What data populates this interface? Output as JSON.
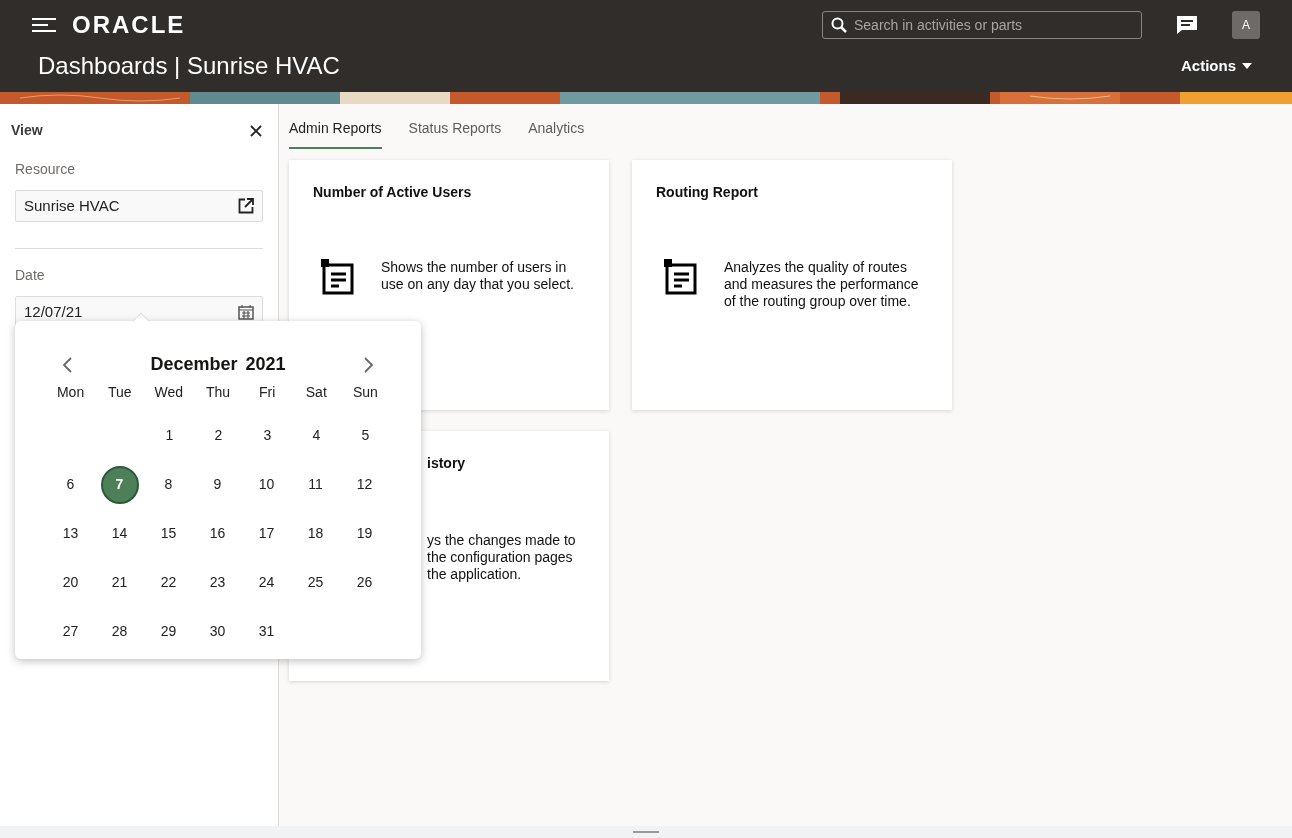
{
  "header": {
    "logo": "ORACLE",
    "search": {
      "placeholder": "Search in activities or parts"
    },
    "avatar": "A",
    "title": "Dashboards | Sunrise HVAC",
    "actions": "Actions"
  },
  "sidebar": {
    "title": "View",
    "fields": [
      {
        "label": "Resource",
        "value": "Sunrise HVAC",
        "kind": "link"
      },
      {
        "label": "Date",
        "value": "12/07/21",
        "kind": "date"
      }
    ]
  },
  "tabs": [
    {
      "label": "Admin Reports",
      "selected": true
    },
    {
      "label": "Status Reports",
      "selected": false
    },
    {
      "label": "Analytics",
      "selected": false
    }
  ],
  "cards": [
    {
      "title": "Number of Active Users",
      "description": [
        "Shows the number of users in",
        "use on any day that you select."
      ],
      "covered": false
    },
    {
      "title": "Routing Report",
      "description": [
        "Analyzes the quality of routes",
        "and measures the performance",
        "of the routing group over time."
      ],
      "covered": false
    },
    {
      "title": "istory",
      "description": [
        "ys the changes made to",
        "the configuration pages",
        "the application."
      ],
      "covered": true
    }
  ],
  "calendar": {
    "month": "December",
    "year": "2021",
    "weekdays": [
      "Mon",
      "Tue",
      "Wed",
      "Thu",
      "Fri",
      "Sat",
      "Sun"
    ],
    "weeks": [
      [
        {
          "label": "1",
          "selected": false
        },
        {
          "label": "2",
          "selected": false
        },
        {
          "label": "3",
          "selected": false
        },
        {
          "label": "4",
          "selected": false
        },
        {
          "label": "5",
          "selected": false
        }
      ],
      [
        {
          "label": "6",
          "selected": false
        },
        {
          "label": "7",
          "selected": true
        },
        {
          "label": "8",
          "selected": false
        },
        {
          "label": "9",
          "selected": false
        },
        {
          "label": "10",
          "selected": false
        },
        {
          "label": "11",
          "selected": false
        },
        {
          "label": "12",
          "selected": false
        }
      ],
      [
        {
          "label": "13",
          "selected": false
        },
        {
          "label": "14",
          "selected": false
        },
        {
          "label": "15",
          "selected": false
        },
        {
          "label": "16",
          "selected": false
        },
        {
          "label": "17",
          "selected": false
        },
        {
          "label": "18",
          "selected": false
        },
        {
          "label": "19",
          "selected": false
        }
      ],
      [
        {
          "label": "20",
          "selected": false
        },
        {
          "label": "21",
          "selected": false
        },
        {
          "label": "22",
          "selected": false
        },
        {
          "label": "23",
          "selected": false
        },
        {
          "label": "24",
          "selected": false
        },
        {
          "label": "25",
          "selected": false
        },
        {
          "label": "26",
          "selected": false
        }
      ],
      [
        {
          "label": "27",
          "selected": false
        },
        {
          "label": "28",
          "selected": false
        },
        {
          "label": "29",
          "selected": false
        },
        {
          "label": "30",
          "selected": false
        },
        {
          "label": "31",
          "selected": false
        }
      ]
    ]
  }
}
